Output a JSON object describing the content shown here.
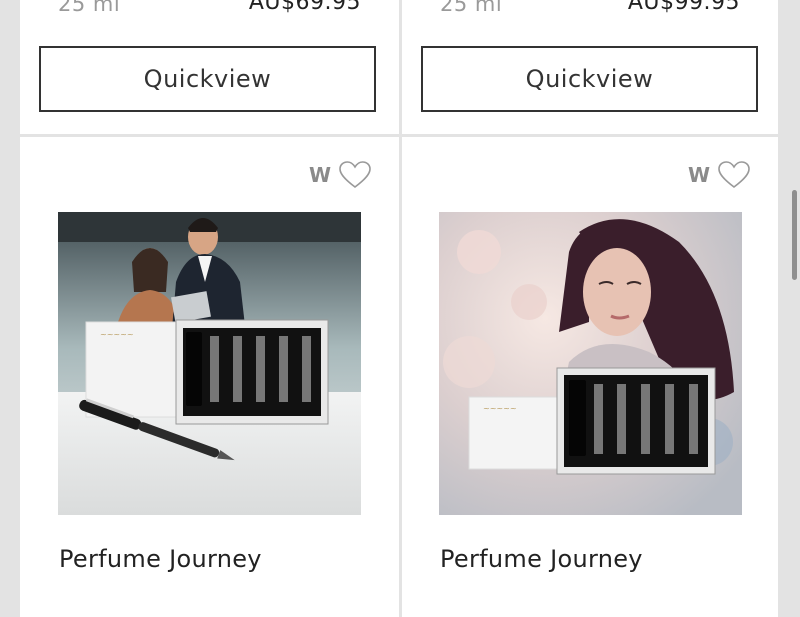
{
  "products_top": [
    {
      "size": "25 ml",
      "price": "AU$69.95",
      "button": "Quickview"
    },
    {
      "size": "25 ml",
      "price": "AU$99.95",
      "button": "Quickview"
    }
  ],
  "products_bottom": [
    {
      "wishlist_letter": "W",
      "title": "Perfume Journey",
      "image": "business-couple-pen-gift-set",
      "heart_icon": "heart-outline-icon"
    },
    {
      "wishlist_letter": "W",
      "title": "Perfume Journey",
      "image": "woman-blossom-gift-set",
      "heart_icon": "heart-outline-icon"
    }
  ]
}
